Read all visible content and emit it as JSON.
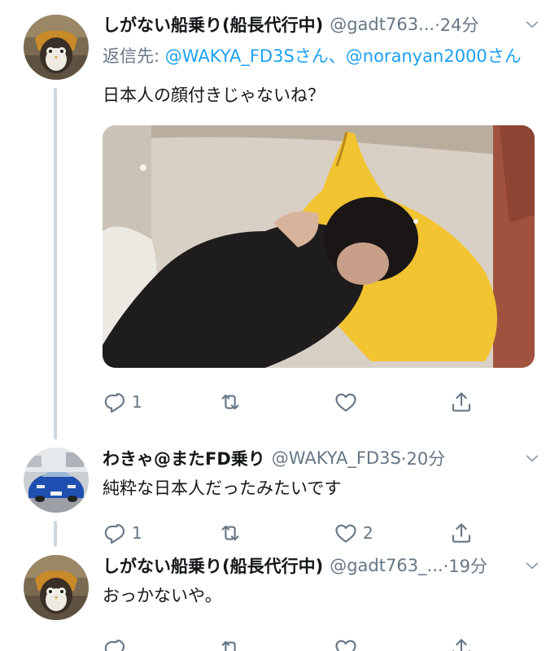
{
  "tweets": [
    {
      "name": "しがない船乗り(船長代行中)",
      "handle": "@gadt763...",
      "time": "·24分",
      "reply_prefix": "返信先: ",
      "reply_mentions": "@WAKYA_FD3Sさん、@noranyan2000さん",
      "text": "日本人の顔付きじゃないね？",
      "actions": {
        "reply_count": "1",
        "retweet_count": "",
        "like_count": ""
      }
    },
    {
      "name": "わきゃ@またFD乗り",
      "handle": "@WAKYA_FD3S",
      "time": "·20分",
      "text": "純粋な日本人だったみたいです",
      "actions": {
        "reply_count": "1",
        "retweet_count": "",
        "like_count": "2"
      }
    },
    {
      "name": "しがない船乗り(船長代行中)",
      "handle": "@gadt763_...",
      "time": "·19分",
      "text": "おっかないや。",
      "actions": {
        "reply_count": "",
        "retweet_count": "",
        "like_count": ""
      }
    }
  ],
  "icons": {
    "reply": "reply-icon",
    "retweet": "retweet-icon",
    "like": "heart-icon",
    "share": "share-icon",
    "menu": "chevron-down-icon"
  },
  "colors": {
    "text": "#14171a",
    "secondary": "#657786",
    "link": "#1da1f2",
    "thread_line": "#ccd6dd",
    "background": "#ffffff"
  }
}
